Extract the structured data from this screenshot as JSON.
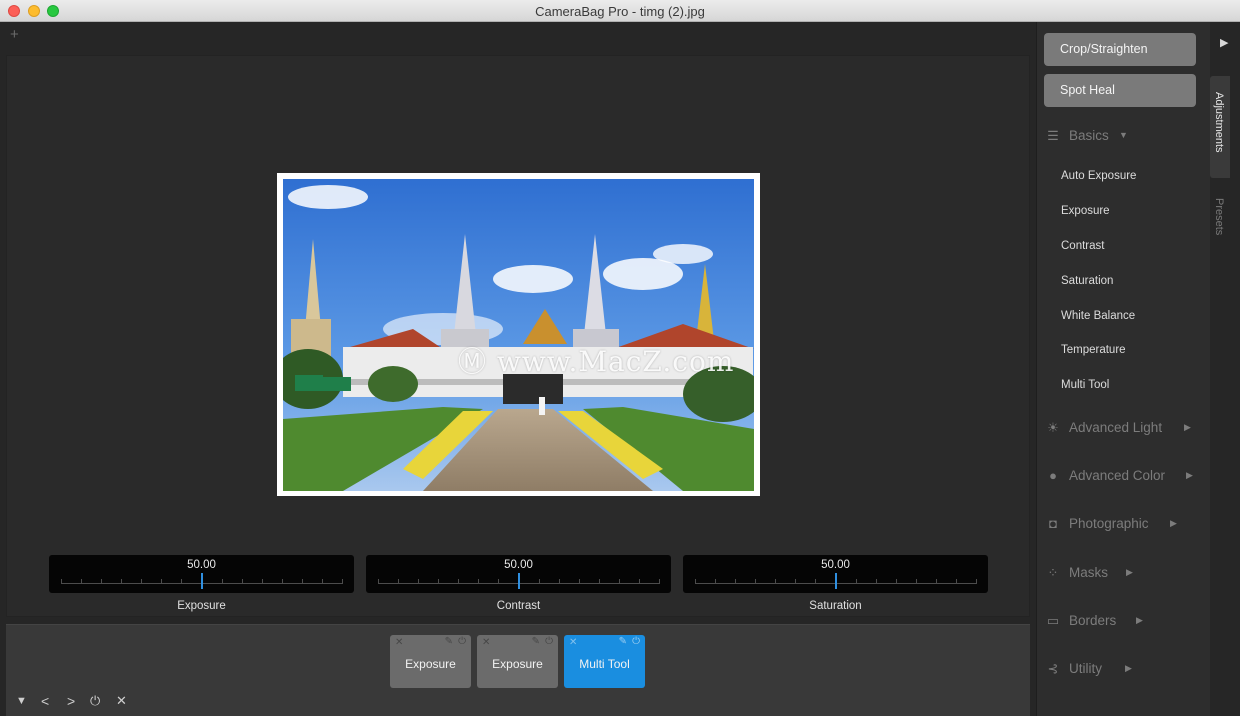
{
  "window": {
    "title": "CameraBag Pro - timg (2).jpg"
  },
  "workspace": {
    "add_label": "+",
    "watermark": "Ⓜ www.MacZ.com"
  },
  "sliders": [
    {
      "value": "50.00",
      "label": "Exposure",
      "position": 0.5
    },
    {
      "value": "50.00",
      "label": "Contrast",
      "position": 0.5
    },
    {
      "value": "50.00",
      "label": "Saturation",
      "position": 0.5
    }
  ],
  "tray": {
    "chips": [
      {
        "label": "Exposure",
        "active": false
      },
      {
        "label": "Exposure",
        "active": false
      },
      {
        "label": "Multi Tool",
        "active": true
      }
    ],
    "controls": [
      "▼",
      "<",
      ">",
      "⏻",
      "✕"
    ]
  },
  "panel": {
    "crop_button": "Crop/Straighten",
    "spot_heal_button": "Spot Heal",
    "basics": {
      "label": "Basics",
      "items": [
        "Auto Exposure",
        "Exposure",
        "Contrast",
        "Saturation",
        "White Balance",
        "Temperature",
        "Multi Tool"
      ]
    },
    "sections": [
      {
        "label": "Advanced Light",
        "icon": "sun-icon"
      },
      {
        "label": "Advanced Color",
        "icon": "color-circles-icon"
      },
      {
        "label": "Photographic",
        "icon": "camera-icon"
      },
      {
        "label": "Masks",
        "icon": "mask-dots-icon"
      },
      {
        "label": "Borders",
        "icon": "border-frame-icon"
      },
      {
        "label": "Utility",
        "icon": "utility-icon"
      }
    ]
  },
  "tabs": {
    "collapse": "▶",
    "adjustments": "Adjustments",
    "presets": "Presets"
  },
  "colors": {
    "accent": "#1a8ee0",
    "panel_bg": "#2d2d2d",
    "canvas_bg": "#2a2a2a"
  }
}
